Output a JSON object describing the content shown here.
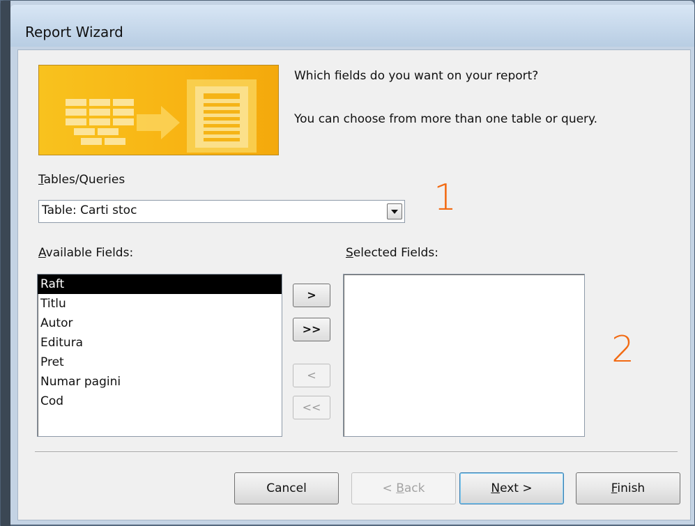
{
  "window": {
    "title": "Report Wizard"
  },
  "banner": {
    "icon": "report-wizard-illustration"
  },
  "intro": {
    "question": "Which fields do you want on your report?",
    "hint": "You can choose from more than one table or query."
  },
  "tables": {
    "label_accel": "T",
    "label_rest": "ables/Queries",
    "selected": "Table: Carti stoc"
  },
  "available": {
    "label_accel": "A",
    "label_rest": "vailable Fields:",
    "items": [
      "Raft",
      "Titlu",
      "Autor",
      "Editura",
      "Pret",
      "Numar pagini",
      "Cod"
    ],
    "selected_index": 0
  },
  "selected": {
    "label_accel": "S",
    "label_rest": "elected Fields:",
    "items": []
  },
  "move_buttons": {
    "add_one": ">",
    "add_all": ">>",
    "remove_one": "<",
    "remove_all": "<<"
  },
  "annotations": {
    "first": "1",
    "second": "2"
  },
  "footer": {
    "cancel": "Cancel",
    "back_prefix": "< ",
    "back_accel": "B",
    "back_rest": "ack",
    "next_accel": "N",
    "next_rest": "ext >",
    "finish_accel": "F",
    "finish_rest": "inish"
  },
  "colors": {
    "annotation": "#f26a12",
    "banner": "#f8b514",
    "selection": "#000000"
  }
}
